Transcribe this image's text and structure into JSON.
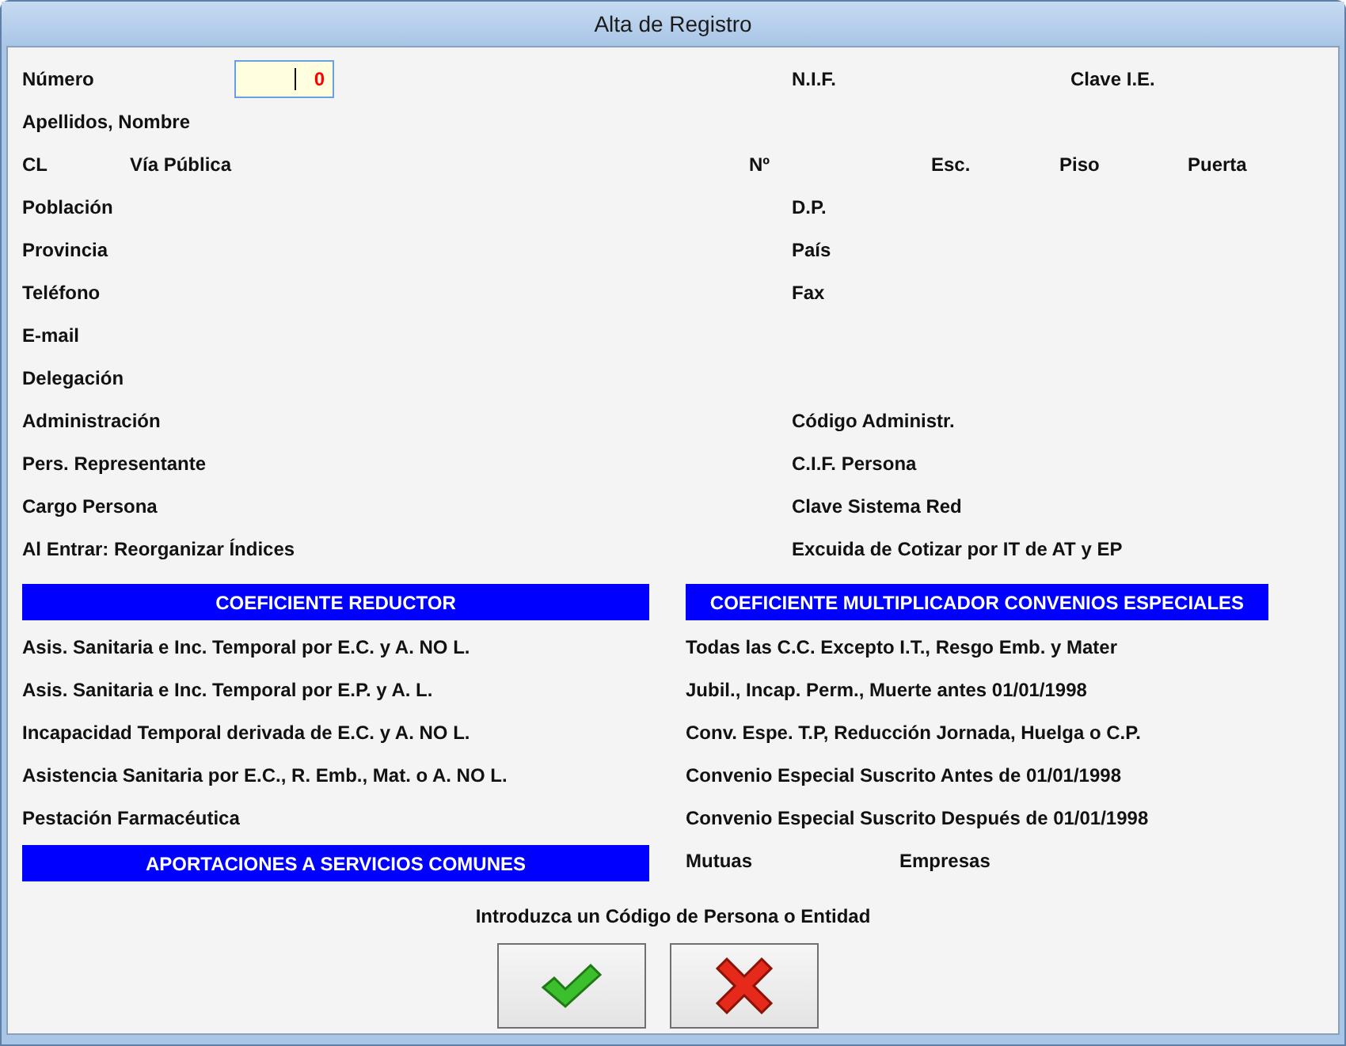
{
  "window": {
    "title": "Alta de Registro"
  },
  "rows": [
    {
      "left": [
        {
          "kind": "label",
          "text": "Número"
        },
        {
          "kind": "field",
          "value": "0"
        }
      ],
      "right": [
        {
          "kind": "label",
          "text": "N.I.F."
        },
        {
          "kind": "label",
          "text": "Clave I.E."
        }
      ]
    },
    {
      "left": [
        {
          "kind": "label",
          "text": "Apellidos, Nombre"
        }
      ],
      "right": []
    },
    {
      "left": [
        {
          "kind": "label",
          "text": "CL"
        },
        {
          "kind": "label",
          "text": "Vía Pública"
        }
      ],
      "right": [
        {
          "kind": "label",
          "text": "Nº"
        },
        {
          "kind": "label",
          "text": "Esc."
        },
        {
          "kind": "label",
          "text": "Piso"
        },
        {
          "kind": "label",
          "text": "Puerta"
        }
      ]
    },
    {
      "left": [
        {
          "kind": "label",
          "text": "Población"
        }
      ],
      "right": [
        {
          "kind": "label",
          "text": "D.P."
        }
      ]
    },
    {
      "left": [
        {
          "kind": "label",
          "text": "Provincia"
        }
      ],
      "right": [
        {
          "kind": "label",
          "text": "País"
        }
      ]
    },
    {
      "left": [
        {
          "kind": "label",
          "text": "Teléfono"
        }
      ],
      "right": [
        {
          "kind": "label",
          "text": "Fax"
        }
      ]
    },
    {
      "left": [
        {
          "kind": "label",
          "text": "E-mail"
        }
      ],
      "right": []
    },
    {
      "left": [
        {
          "kind": "label",
          "text": "Delegación"
        }
      ],
      "right": []
    },
    {
      "left": [
        {
          "kind": "label",
          "text": "Administración"
        }
      ],
      "right": [
        {
          "kind": "label",
          "text": "Código Administr."
        }
      ]
    },
    {
      "left": [
        {
          "kind": "label",
          "text": "Pers. Representante"
        }
      ],
      "right": [
        {
          "kind": "label",
          "text": "C.I.F. Persona"
        }
      ]
    },
    {
      "left": [
        {
          "kind": "label",
          "text": "Cargo Persona"
        }
      ],
      "right": [
        {
          "kind": "label",
          "text": "Clave Sistema Red"
        }
      ]
    },
    {
      "left": [
        {
          "kind": "label",
          "text": "Al Entrar: Reorganizar Índices"
        }
      ],
      "right": [
        {
          "kind": "label",
          "text": "Excuida de Cotizar por IT de AT y EP"
        }
      ]
    }
  ],
  "columns": [
    {
      "items": [
        {
          "kind": "header",
          "text": "COEFICIENTE REDUCTOR"
        },
        {
          "kind": "label",
          "texts": [
            "Asis. Sanitaria e Inc. Temporal por E.C. y A. NO L."
          ]
        },
        {
          "kind": "label",
          "texts": [
            "Asis. Sanitaria e Inc. Temporal por E.P. y A. L."
          ]
        },
        {
          "kind": "label",
          "texts": [
            "Incapacidad Temporal derivada de E.C. y A. NO L."
          ]
        },
        {
          "kind": "label",
          "texts": [
            "Asistencia Sanitaria por E.C., R. Emb., Mat. o A. NO L."
          ]
        },
        {
          "kind": "label",
          "texts": [
            "Pestación Farmacéutica"
          ]
        },
        {
          "kind": "header",
          "text": "APORTACIONES A SERVICIOS COMUNES"
        }
      ]
    },
    {
      "items": [
        {
          "kind": "header",
          "text": "COEFICIENTE MULTIPLICADOR CONVENIOS ESPECIALES"
        },
        {
          "kind": "label",
          "texts": [
            "Todas las C.C. Excepto I.T., Resgo Emb. y Mater"
          ]
        },
        {
          "kind": "label",
          "texts": [
            "Jubil., Incap. Perm., Muerte antes 01/01/1998"
          ]
        },
        {
          "kind": "label",
          "texts": [
            "Conv. Espe. T.P, Reducción Jornada, Huelga o C.P."
          ]
        },
        {
          "kind": "label",
          "texts": [
            "Convenio Especial Suscrito Antes de 01/01/1998"
          ]
        },
        {
          "kind": "label",
          "texts": [
            "Convenio Especial Suscrito Después de 01/01/1998"
          ]
        },
        {
          "kind": "label",
          "texts": [
            "Mutuas",
            "Empresas"
          ]
        }
      ]
    }
  ],
  "message": "Introduzca un Código de Persona o Entidad",
  "buttons": [
    {
      "kind": "ok"
    },
    {
      "kind": "cancel"
    }
  ]
}
